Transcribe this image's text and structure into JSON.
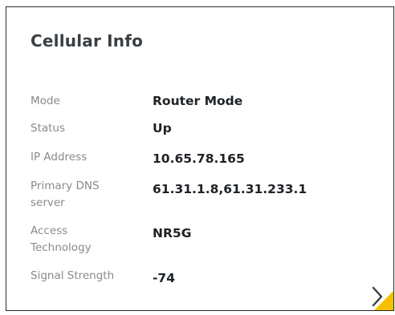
{
  "card": {
    "title": "Cellular Info",
    "rows": [
      {
        "label": "Mode",
        "value": "Router Mode"
      },
      {
        "label": "Status",
        "value": "Up"
      },
      {
        "label": "IP Address",
        "value": "10.65.78.165"
      },
      {
        "label": "Primary DNS server",
        "value": "61.31.1.8,61.31.233.1"
      },
      {
        "label": "Access Technology",
        "value": "NR5G"
      },
      {
        "label": "Signal Strength",
        "value": "-74"
      }
    ]
  },
  "colors": {
    "accent": "#f6c000",
    "label": "#8a8a8a",
    "value": "#1e2226",
    "title": "#3a3f44"
  },
  "icons": {
    "next": "chevron-right-icon"
  }
}
